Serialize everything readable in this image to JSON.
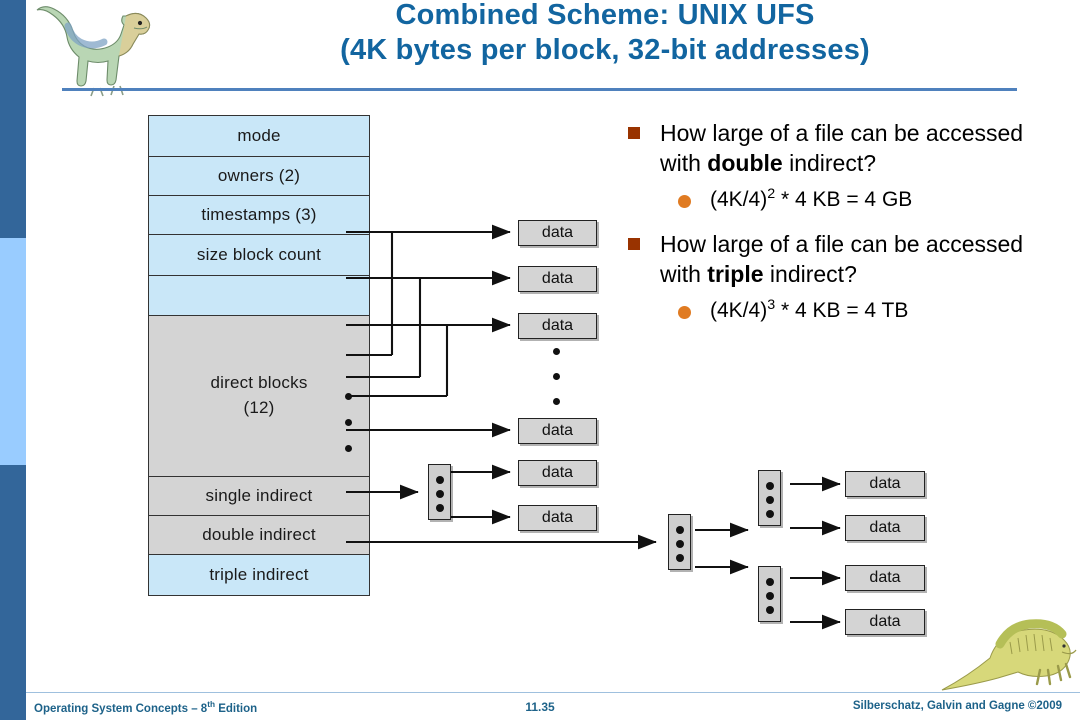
{
  "slide": {
    "title_line_1": "Combined Scheme:  UNIX UFS",
    "title_line_2": "(4K bytes per block, 32-bit addresses)",
    "title_color": "#1265a0",
    "rule_color": "#4f81bd"
  },
  "rail": {
    "top_color": "#33669a",
    "mid_color": "#99ccff",
    "bottom_color": "#33669a"
  },
  "inode": {
    "rows": [
      {
        "label": "mode",
        "fill": "blue"
      },
      {
        "label": "owners (2)",
        "fill": "blue"
      },
      {
        "label": "timestamps (3)",
        "fill": "blue"
      },
      {
        "label": "size block count",
        "fill": "blue"
      },
      {
        "label": "",
        "fill": "blue"
      },
      {
        "label": "direct blocks",
        "label2": "(12)",
        "fill": "grey"
      },
      {
        "label": "single indirect",
        "fill": "grey"
      },
      {
        "label": "double indirect",
        "fill": "grey"
      },
      {
        "label": "triple indirect",
        "fill": "blue"
      }
    ],
    "blue_fill": "#c9e7f8",
    "grey_fill": "#d4d4d4"
  },
  "diagram": {
    "data_label": "data",
    "direct_data_blocks": 3,
    "single_indirect_data_blocks": 3,
    "double_indirect_data_blocks": 4,
    "index_block_dots": 3,
    "ellipsis_dots": 3,
    "data_fill": "#d4d4d4",
    "index_fill": "#cfcfcf"
  },
  "bullets": [
    {
      "level": 1,
      "marker": "square-bullet",
      "text_before": "How large of a file can be accessed with ",
      "emphasis": "double",
      "text_after": " indirect?"
    },
    {
      "level": 2,
      "marker": "round-bullet",
      "base": "(4K/4)",
      "exponent": "2",
      "tail": " * 4 KB = 4 GB"
    },
    {
      "level": 1,
      "marker": "square-bullet",
      "text_before": "How large of a file can be accessed with ",
      "emphasis": "triple",
      "text_after": " indirect?"
    },
    {
      "level": 2,
      "marker": "round-bullet",
      "base": "(4K/4)",
      "exponent": "3",
      "tail": " * 4 KB = 4 TB"
    }
  ],
  "bullet_colors": {
    "square": "#993300",
    "round": "#e07b22"
  },
  "footer": {
    "left_main": "Operating System Concepts  – 8",
    "left_sup": "th",
    "left_tail": " Edition",
    "center": "11.35",
    "right": "Silberschatz, Galvin and Gagne ©2009",
    "color": "#1d6289"
  }
}
